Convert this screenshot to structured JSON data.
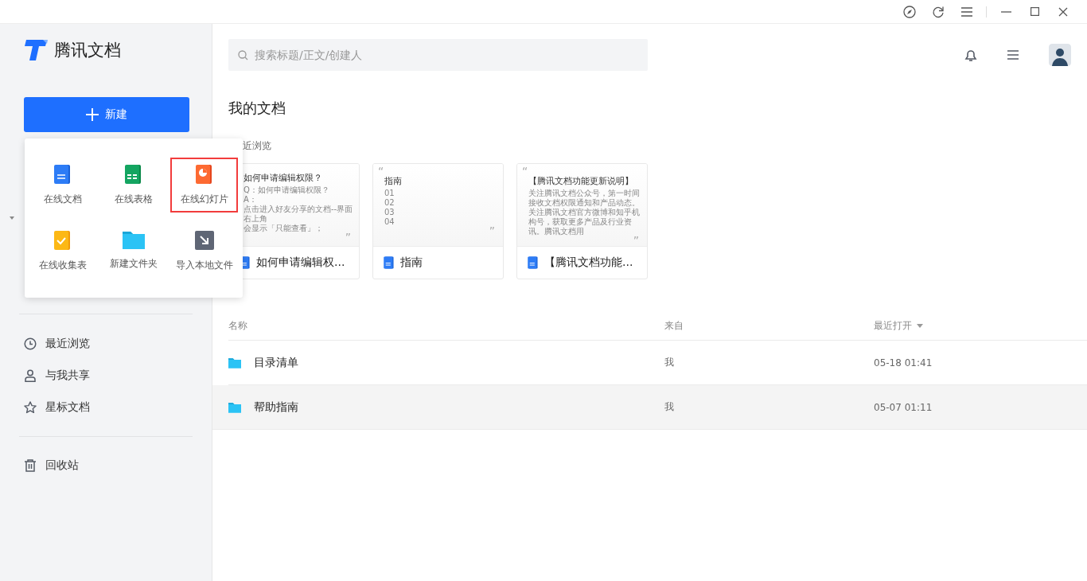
{
  "titlebar": {
    "buttons": [
      {
        "kind": "compass"
      },
      {
        "kind": "refresh"
      },
      {
        "kind": "menu"
      },
      {
        "kind": "minimize"
      },
      {
        "kind": "maximize"
      },
      {
        "kind": "close"
      }
    ]
  },
  "sidebar": {
    "logo": "腾讯文档",
    "new_button": "新建",
    "nav": [
      {
        "label": "最近浏览",
        "kind": "clock"
      },
      {
        "label": "与我共享",
        "kind": "user"
      },
      {
        "label": "星标文档",
        "kind": "star"
      }
    ],
    "trash": {
      "label": "回收站"
    }
  },
  "new_menu": {
    "items": [
      {
        "label": "在线文档",
        "kind": "doc",
        "highlighted": false
      },
      {
        "label": "在线表格",
        "kind": "sheet",
        "highlighted": false
      },
      {
        "label": "在线幻灯片",
        "kind": "slide",
        "highlighted": true
      },
      {
        "label": "在线收集表",
        "kind": "form",
        "highlighted": false
      },
      {
        "label": "新建文件夹",
        "kind": "folder",
        "highlighted": false
      },
      {
        "label": "导入本地文件",
        "kind": "import",
        "highlighted": false
      }
    ]
  },
  "search": {
    "placeholder": "搜索标题/正文/创建人"
  },
  "heading": "我的文档",
  "recent_label": "近浏览",
  "recent": [
    {
      "title": "如何申请编辑权限？",
      "lines": [
        "Q：如何申请编辑权限？",
        "A：",
        "点击进入好友分享的文档--界面右上角",
        "会显示「只能查看」；"
      ],
      "quote_close": "”",
      "name": "如何申请编辑权..."
    },
    {
      "quote_open": "“",
      "title": "指南",
      "lines": [
        "01",
        "02",
        "03",
        "04"
      ],
      "quote_close": "”",
      "name": "指南"
    },
    {
      "quote_open": "“",
      "title": "【腾讯文档功能更新说明】",
      "lines": [
        "关注腾讯文档公众号，第一时间接收文档权限通知和产品动态。",
        "关注腾讯文档官方微博和知乎机构号，获取更多产品及行业资讯。腾讯文档用"
      ],
      "quote_close": "”",
      "name": "【腾讯文档功能..."
    }
  ],
  "table": {
    "columns": [
      {
        "label": "名称",
        "sorted": false
      },
      {
        "label": "来自",
        "sorted": false
      },
      {
        "label": "最近打开",
        "sorted": true
      }
    ],
    "rows": [
      {
        "name": "目录清单",
        "from": "我",
        "opened": "05-18 01:41",
        "selected": false
      },
      {
        "name": "帮助指南",
        "from": "我",
        "opened": "05-07 01:11",
        "selected": true
      }
    ]
  }
}
